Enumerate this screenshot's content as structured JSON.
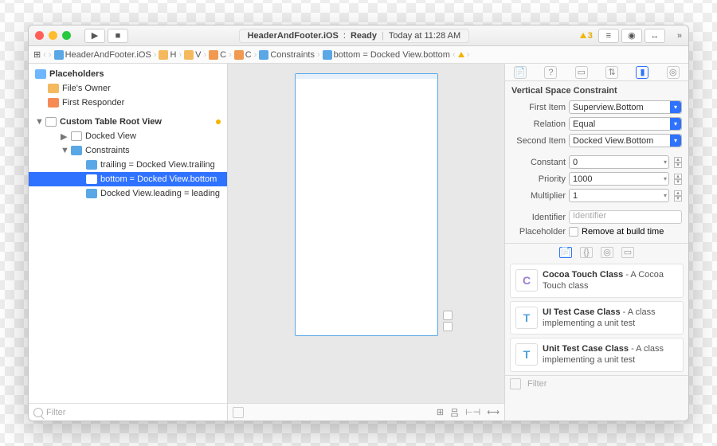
{
  "titlebar": {
    "project": "HeaderAndFooter.iOS",
    "state": "Ready",
    "time": "Today at 11:28 AM",
    "warnings": "3"
  },
  "breadcrumb": {
    "items": [
      "HeaderAndFooter.iOS",
      "H",
      "V",
      "C",
      "C",
      "Constraints",
      "bottom = Docked View.bottom"
    ]
  },
  "navigator": {
    "placeholders_header": "Placeholders",
    "files_owner": "File's Owner",
    "first_responder": "First Responder",
    "root_view": "Custom Table Root View",
    "docked_view": "Docked View",
    "constraints_header": "Constraints",
    "items": [
      "trailing = Docked View.trailing",
      "bottom = Docked View.bottom",
      "Docked View.leading = leading"
    ],
    "filter_placeholder": "Filter"
  },
  "inspector": {
    "title": "Vertical Space Constraint",
    "first_item_label": "First Item",
    "first_item": "Superview.Bottom",
    "relation_label": "Relation",
    "relation": "Equal",
    "second_item_label": "Second Item",
    "second_item": "Docked View.Bottom",
    "constant_label": "Constant",
    "constant": "0",
    "priority_label": "Priority",
    "priority": "1000",
    "multiplier_label": "Multiplier",
    "multiplier": "1",
    "identifier_label": "Identifier",
    "identifier_placeholder": "Identifier",
    "placeholder_label": "Placeholder",
    "remove_label": "Remove at build time"
  },
  "library": {
    "items": [
      {
        "icon": "C",
        "title": "Cocoa Touch Class",
        "desc": " - A Cocoa Touch class"
      },
      {
        "icon": "T",
        "title": "UI Test Case Class",
        "desc": " - A class implementing a unit test"
      },
      {
        "icon": "T",
        "title": "Unit Test Case Class",
        "desc": " - A class implementing a unit test"
      }
    ],
    "filter_placeholder": "Filter"
  }
}
